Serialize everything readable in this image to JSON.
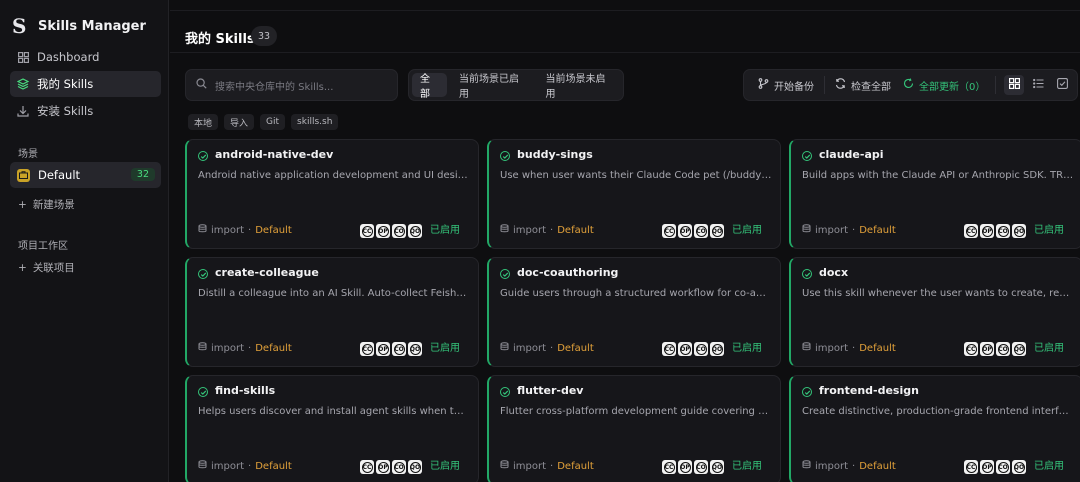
{
  "sidebar": {
    "brand": {
      "logo": "S",
      "title": "Skills Manager"
    },
    "nav": [
      {
        "label": "Dashboard",
        "icon": "grid-icon"
      },
      {
        "label": "我的 Skills",
        "icon": "layers-icon"
      },
      {
        "label": "安装 Skills",
        "icon": "download-icon"
      }
    ],
    "scenes_label": "场景",
    "scene": {
      "label": "Default",
      "count": "32"
    },
    "new_scene": "新建场景",
    "projects_label": "项目工作区",
    "link_project": "关联项目"
  },
  "header": {
    "title": "我的 Skills",
    "count": "33"
  },
  "search": {
    "placeholder": "搜索中央仓库中的 Skills..."
  },
  "filters": [
    "全部",
    "当前场景已启用",
    "当前场景未启用"
  ],
  "actions": {
    "backup": "开始备份",
    "check_all": "检查全部",
    "update_all": "全部更新（0）"
  },
  "chips": [
    "本地",
    "导入",
    "Git",
    "skills.sh"
  ],
  "compat_badges": [
    "CC",
    "OP",
    "CO",
    "QO"
  ],
  "cards": [
    {
      "title": "android-native-dev",
      "desc": "Android native application development and UI design ...",
      "source": "import",
      "scene": "Default",
      "status": "已启用"
    },
    {
      "title": "buddy-sings",
      "desc": "Use when user wants their Claude Code pet (/buddy) to...",
      "source": "import",
      "scene": "Default",
      "status": "已启用"
    },
    {
      "title": "claude-api",
      "desc": "Build apps with the Claude API or Anthropic SDK. TRIG...",
      "source": "import",
      "scene": "Default",
      "status": "已启用"
    },
    {
      "title": "create-colleague",
      "desc": "Distill a colleague into an AI Skill. Auto-collect Feishu/Di...",
      "source": "import",
      "scene": "Default",
      "status": "已启用"
    },
    {
      "title": "doc-coauthoring",
      "desc": "Guide users through a structured workflow for co-auth...",
      "source": "import",
      "scene": "Default",
      "status": "已启用"
    },
    {
      "title": "docx",
      "desc": "Use this skill whenever the user wants to create, read, e...",
      "source": "import",
      "scene": "Default",
      "status": "已启用"
    },
    {
      "title": "find-skills",
      "desc": "Helps users discover and install agent skills when they a...",
      "source": "import",
      "scene": "Default",
      "status": "已启用"
    },
    {
      "title": "flutter-dev",
      "desc": "Flutter cross-platform development guide covering wid...",
      "source": "import",
      "scene": "Default",
      "status": "已启用"
    },
    {
      "title": "frontend-design",
      "desc": "Create distinctive, production-grade frontend interfaces...",
      "source": "import",
      "scene": "Default",
      "status": "已启用"
    }
  ],
  "colors": {
    "accent": "#34c47a",
    "scene": "#e2a13a",
    "background": "#0e0e10"
  }
}
